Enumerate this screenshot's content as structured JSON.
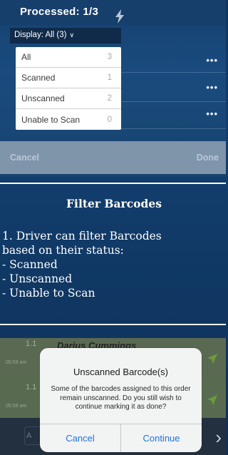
{
  "header": {
    "processed": "Processed:  1/3"
  },
  "display": {
    "label": "Display: All (3)"
  },
  "filter_options": [
    {
      "label": "All",
      "count": "3"
    },
    {
      "label": "Scanned",
      "count": "1"
    },
    {
      "label": "Unscanned",
      "count": "2"
    },
    {
      "label": "Unable to Scan",
      "count": "0"
    }
  ],
  "row_menu": "•••",
  "action_bar": {
    "cancel": "Cancel",
    "done": "Done"
  },
  "caption": {
    "title": "Filter Barcodes",
    "lines": [
      "1. Driver can filter Barcodes",
      "based on their status:",
      "- Scanned",
      "- Unscanned",
      "- Unable to Scan"
    ]
  },
  "bottom": {
    "driver_name": "Darius Cummings",
    "rows": [
      {
        "number": "1.1",
        "time": "05:59 am"
      },
      {
        "number": "1.1",
        "time": "05:59 am"
      }
    ],
    "small_button": "A"
  },
  "alert": {
    "title": "Unscanned Barcode(s)",
    "message": "Some of the barcodes assigned to this order remain unscanned. Do you still wish to continue marking it as done?",
    "cancel": "Cancel",
    "continue": "Continue"
  }
}
